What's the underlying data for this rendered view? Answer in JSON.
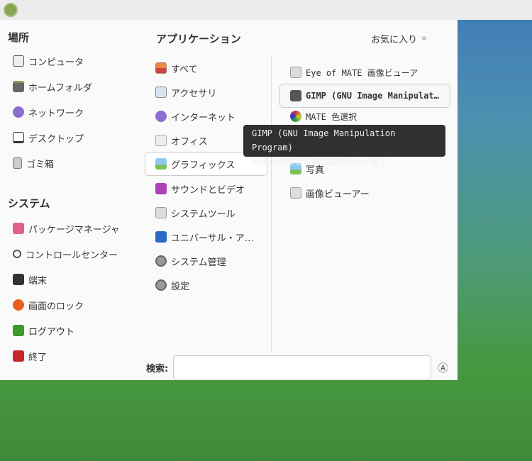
{
  "places": {
    "title": "場所",
    "items": [
      "コンピュータ",
      "ホームフォルダ",
      "ネットワーク",
      "デスクトップ",
      "ゴミ箱"
    ]
  },
  "system": {
    "title": "システム",
    "items": [
      "パッケージマネージャ",
      "コントロールセンター",
      "端末",
      "画面のロック",
      "ログアウト",
      "終了"
    ]
  },
  "apps": {
    "title": "アプリケーション",
    "favorites": "お気に入り",
    "categories": [
      "すべて",
      "アクセサリ",
      "インターネット",
      "オフィス",
      "グラフィックス",
      "サウンドとビデオ",
      "システムツール",
      "ユニバーサル・ア…",
      "システム管理",
      "設定"
    ],
    "selected": "グラフィックス"
  },
  "graphics_apps": [
    "Eye of MATE 画像ビューア",
    "GIMP (GNU Image Manipulat…",
    "MATE 色選択",
    "写真",
    "画像ビューアー"
  ],
  "tooltip": {
    "line1": "GIMP (GNU Image Manipulation Program)",
    "line2": "画像の作成と写真の編集を行います"
  },
  "search": {
    "label": "検索:",
    "value": ""
  },
  "colors": {
    "accent": "#87a556"
  }
}
